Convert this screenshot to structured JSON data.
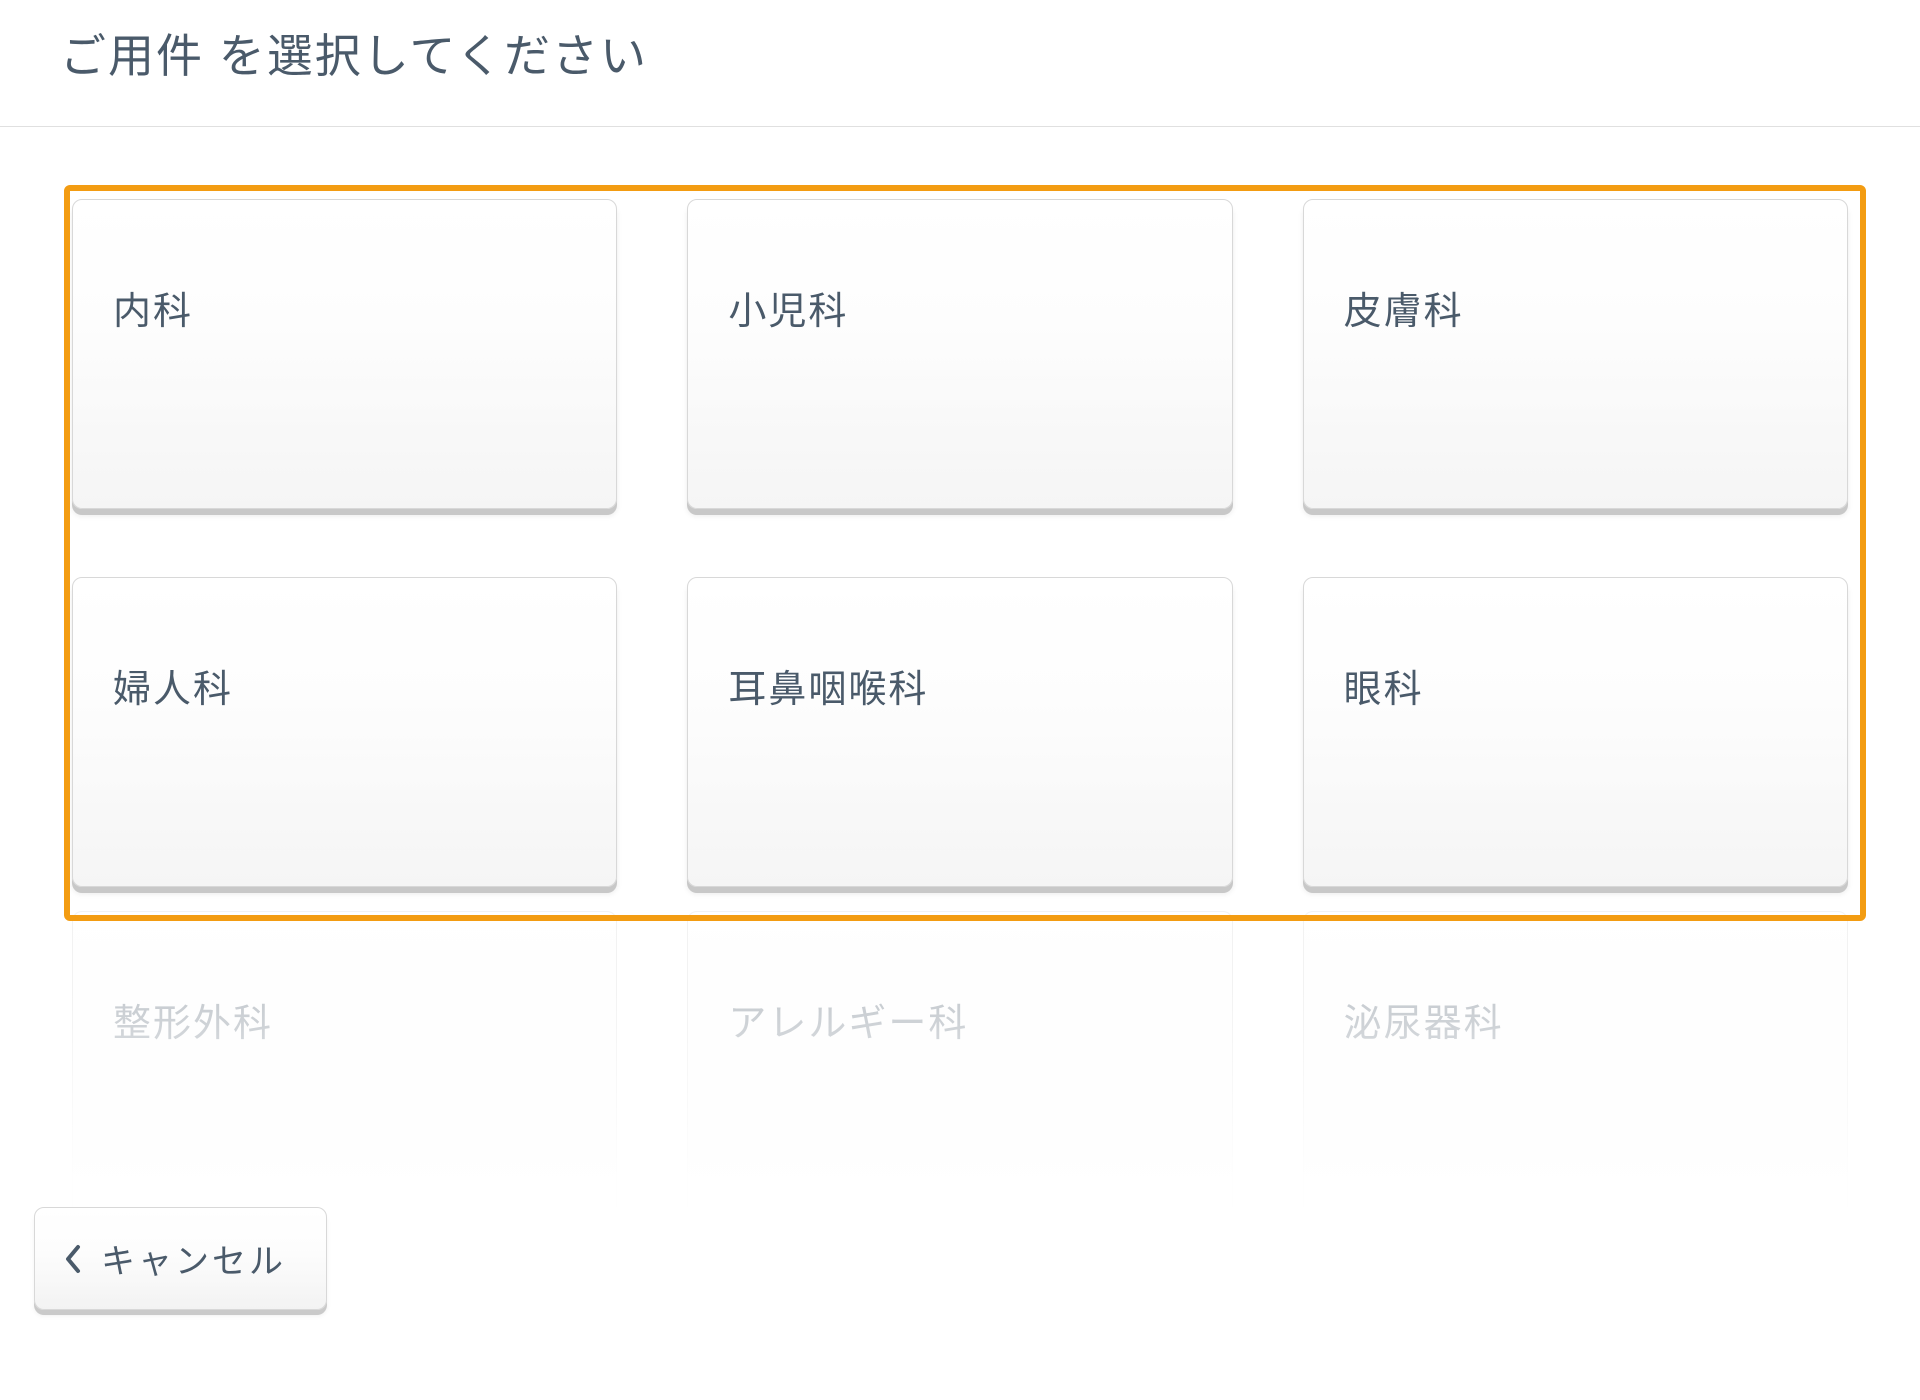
{
  "header": {
    "title": "ご用件 を選択してください"
  },
  "options": [
    {
      "label": "内科"
    },
    {
      "label": "小児科"
    },
    {
      "label": "皮膚科"
    },
    {
      "label": "婦人科"
    },
    {
      "label": "耳鼻咽喉科"
    },
    {
      "label": "眼科"
    },
    {
      "label": "整形外科"
    },
    {
      "label": "アレルギー科"
    },
    {
      "label": "泌尿器科"
    }
  ],
  "footer": {
    "cancel_label": "キャンセル"
  },
  "colors": {
    "highlight": "#f39c12",
    "text": "#4a5a6a"
  }
}
